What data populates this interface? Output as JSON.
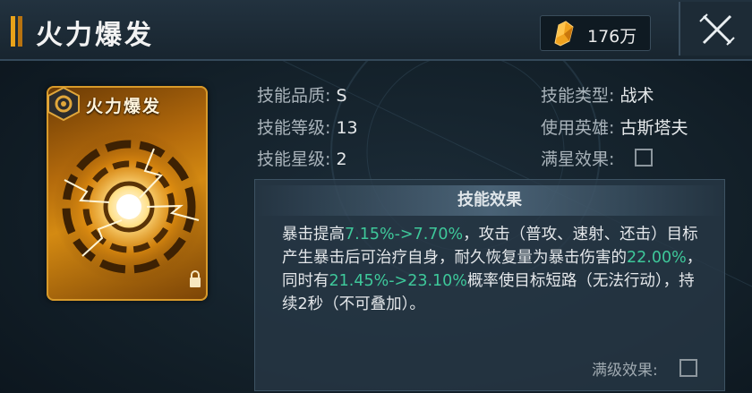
{
  "header": {
    "title": "火力爆发",
    "currency_amount": "176万",
    "currency_icon": "crystal-icon",
    "accent_color": "#e8a21a"
  },
  "card": {
    "name": "火力爆发"
  },
  "info": {
    "quality_label": "技能品质:",
    "quality_value": "S",
    "level_label": "技能等级:",
    "level_value": "13",
    "star_label": "技能星级:",
    "star_value": "2",
    "type_label": "技能类型:",
    "type_value": "战术",
    "hero_label": "使用英雄:",
    "hero_value": "古斯塔夫",
    "full_star_label": "满星效果:"
  },
  "effect": {
    "title": "技能效果",
    "t1": "暴击提高",
    "h1": "7.15%->7.70%",
    "t2": "，攻击（普攻、速射、还击）目标产生暴击后可治疗自身，耐久恢复量为暴击伤害的",
    "h2": "22.00%",
    "t3": "，同时有",
    "h3": "21.45%->23.10%",
    "t4": "概率使目标短路（无法行动），持续2秒（不可叠加）。",
    "highlight_color": "#3ec89a",
    "max_level_label": "满级效果:"
  }
}
